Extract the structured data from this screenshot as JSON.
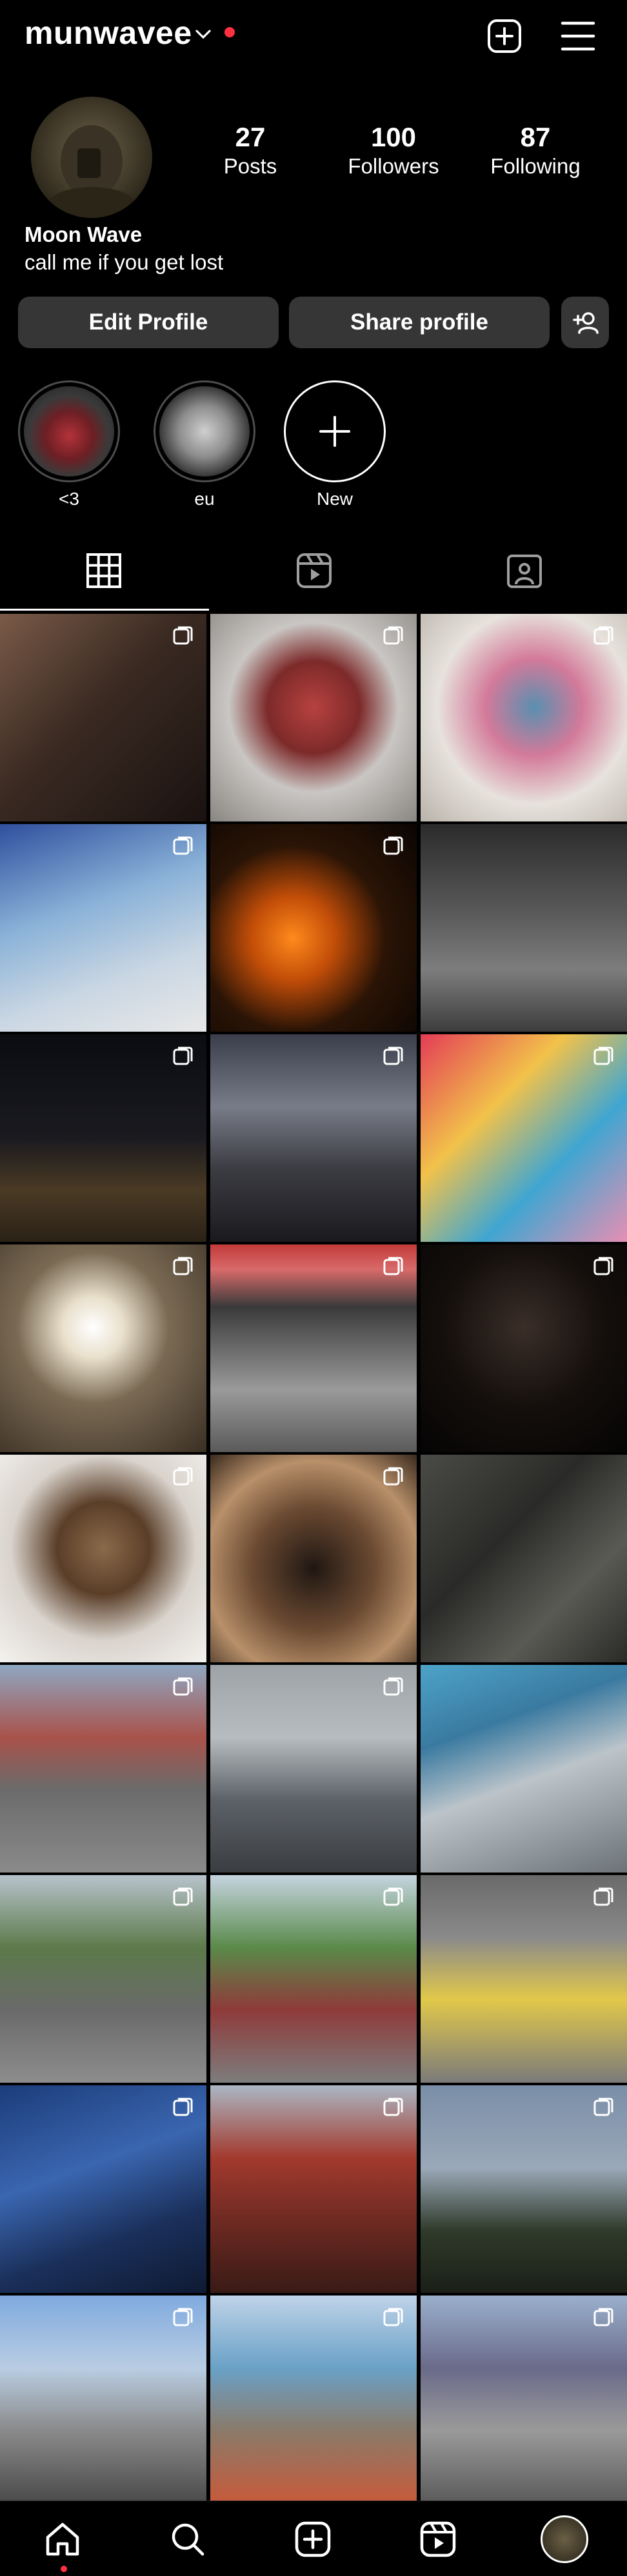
{
  "header": {
    "username": "munwavee"
  },
  "profile": {
    "stats": [
      {
        "value": "27",
        "label": "Posts"
      },
      {
        "value": "100",
        "label": "Followers"
      },
      {
        "value": "87",
        "label": "Following"
      }
    ],
    "name": "Moon Wave",
    "bio": "call me if you get lost"
  },
  "actions": {
    "edit_profile": "Edit Profile",
    "share_profile": "Share profile"
  },
  "highlights": [
    {
      "label": "<3"
    },
    {
      "label": "eu"
    },
    {
      "label": "New"
    }
  ],
  "tabs": [
    "grid",
    "reels",
    "tagged"
  ],
  "posts": [
    {
      "scene": "two people selfie",
      "multi": true
    },
    {
      "scene": "mirror selfie red sweater",
      "multi": true
    },
    {
      "scene": "mirror selfie blue hoodie",
      "multi": true
    },
    {
      "scene": "tv screen selfie",
      "multi": true
    },
    {
      "scene": "jack-o-lanterns",
      "multi": true
    },
    {
      "scene": "empty warehouse lights",
      "multi": false
    },
    {
      "scene": "night street",
      "multi": true
    },
    {
      "scene": "parking lot at night",
      "multi": true
    },
    {
      "scene": "toy store",
      "multi": true
    },
    {
      "scene": "moon lamp candles",
      "multi": true
    },
    {
      "scene": "metro station",
      "multi": true
    },
    {
      "scene": "string lights photos",
      "multi": true
    },
    {
      "scene": "siamese cat",
      "multi": true
    },
    {
      "scene": "siamese cat closeup",
      "multi": true
    },
    {
      "scene": "shadow on ground",
      "multi": false
    },
    {
      "scene": "city street",
      "multi": true
    },
    {
      "scene": "rainy rail tracks",
      "multi": true
    },
    {
      "scene": "train window",
      "multi": false
    },
    {
      "scene": "sidewalk tree car",
      "multi": true
    },
    {
      "scene": "bike path",
      "multi": true
    },
    {
      "scene": "train door",
      "multi": true
    },
    {
      "scene": "blue interior",
      "multi": true
    },
    {
      "scene": "red stairs",
      "multi": true
    },
    {
      "scene": "trees sky",
      "multi": true
    },
    {
      "scene": "skyline road",
      "multi": true
    },
    {
      "scene": "mural building",
      "multi": true
    },
    {
      "scene": "building with clock",
      "multi": true
    }
  ],
  "bottom_nav": [
    "home-icon",
    "search-icon",
    "create-icon",
    "reels-icon",
    "profile-avatar"
  ],
  "colors": {
    "accent_red": "#ff3040",
    "button_bg": "#363636"
  }
}
